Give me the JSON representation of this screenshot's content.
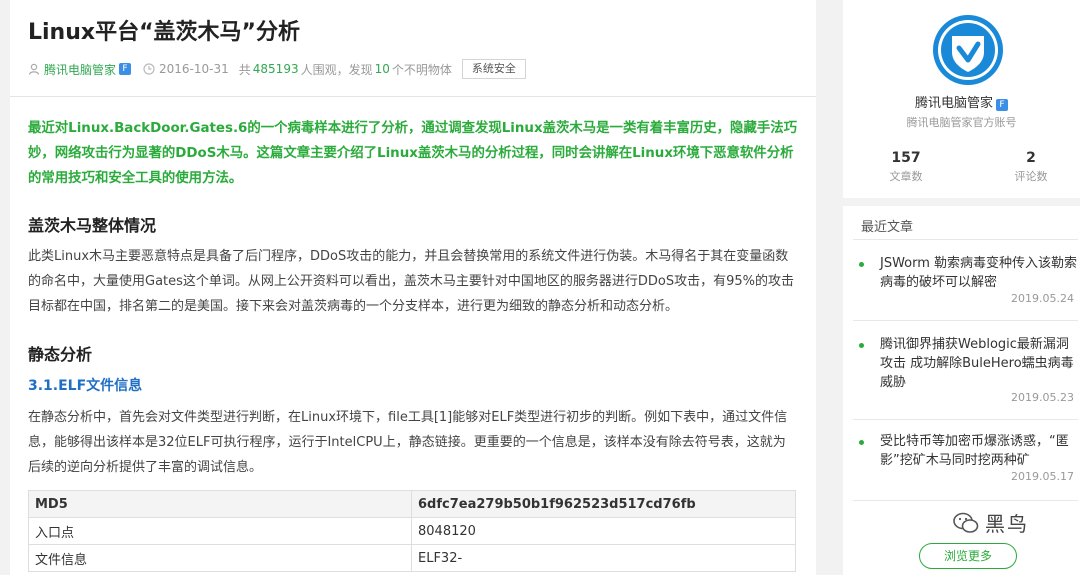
{
  "article": {
    "title": "Linux平台“盖茨木马”分析",
    "meta": {
      "author": "腾讯电脑管家",
      "verified_badge": "F",
      "date": "2016-10-31",
      "views_prefix": "共",
      "views": "485193",
      "views_suffix": "人围观，发现",
      "finds": "10",
      "finds_suffix": "个不明物体",
      "tag": "系统安全"
    },
    "summary": "最近对Linux.BackDoor.Gates.6的一个病毒样本进行了分析，通过调查发现Linux盖茨木马是一类有着丰富历史，隐藏手法巧妙，网络攻击行为显著的DDoS木马。这篇文章主要介绍了Linux盖茨木马的分析过程，同时会讲解在Linux环境下恶意软件分析的常用技巧和安全工具的使用方法。",
    "section1_title": "盖茨木马整体情况",
    "section1_text": "此类Linux木马主要恶意特点是具备了后门程序，DDoS攻击的能力，并且会替换常用的系统文件进行伪装。木马得名于其在变量函数的命名中，大量使用Gates这个单词。从网上公开资料可以看出，盖茨木马主要针对中国地区的服务器进行DDoS攻击，有95%的攻击目标都在中国，排名第二的是美国。接下来会对盖茨病毒的一个分支样本，进行更为细致的静态分析和动态分析。",
    "section2_title": "静态分析",
    "subsection_title": "3.1.ELF文件信息",
    "subsection_text": "在静态分析中，首先会对文件类型进行判断，在Linux环境下，file工具[1]能够对ELF类型进行初步的判断。例如下表中，通过文件信息，能够得出该样本是32位ELF可执行程序，运行于IntelCPU上，静态链接。更重要的一个信息是，该样本没有除去符号表，这就为后续的逆向分析提供了丰富的调试信息。",
    "table": [
      [
        "MD5",
        "6dfc7ea279b50b1f962523d517cd76fb"
      ],
      [
        "入口点",
        "8048120"
      ],
      [
        "文件信息",
        "ELF32-"
      ]
    ]
  },
  "sidebar": {
    "name": "腾讯电脑管家",
    "verified_badge": "F",
    "subtitle": "腾讯电脑管家官方账号",
    "stats": [
      {
        "value": "157",
        "label": "文章数"
      },
      {
        "value": "2",
        "label": "评论数"
      }
    ],
    "recent_title": "最近文章",
    "recent": [
      {
        "title": "JSWorm 勒索病毒变种传入该勒索病毒的破坏可以解密",
        "date": "2019.05.24"
      },
      {
        "title": "腾讯御界捕获Weblogic最新漏洞攻击 成功解除BuleHero蠕虫病毒威胁",
        "date": "2019.05.23"
      },
      {
        "title": "受比特币等加密币爆涨诱惑，“匿影”挖矿木马同时挖两种矿",
        "date": "2019.05.17"
      }
    ],
    "browse_more": "浏览更多",
    "watermark": "黑鸟"
  },
  "colors": {
    "accent_green": "#2bab3c",
    "link_blue": "#1f6fc5",
    "shield_blue": "#1a8ad8"
  },
  "icons": {
    "author": "user-icon",
    "date": "clock-icon",
    "logo": "shield-check-logo",
    "watermark": "wechat-icon"
  }
}
